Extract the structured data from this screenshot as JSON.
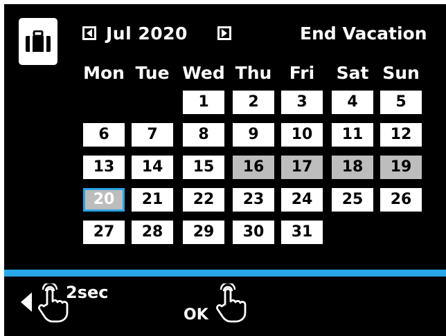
{
  "header": {
    "month_label": "Jul 2020",
    "end_button_label": "End Vacation",
    "prev_icon": "triangle-left-icon",
    "next_icon": "triangle-right-icon",
    "mode_icon": "suitcase-icon"
  },
  "calendar": {
    "weekdays": [
      "Mon",
      "Tue",
      "Wed",
      "Thu",
      "Fri",
      "Sat",
      "Sun"
    ],
    "weeks": [
      [
        "",
        "",
        "1",
        "2",
        "3",
        "4",
        "5"
      ],
      [
        "6",
        "7",
        "8",
        "9",
        "10",
        "11",
        "12"
      ],
      [
        "13",
        "14",
        "15",
        "16",
        "17",
        "18",
        "19"
      ],
      [
        "20",
        "21",
        "22",
        "23",
        "24",
        "25",
        "26"
      ],
      [
        "27",
        "28",
        "29",
        "30",
        "31",
        "",
        ""
      ]
    ],
    "selected_range_days": [
      "16",
      "17",
      "18",
      "19"
    ],
    "today": "20"
  },
  "footer": {
    "hold_label": "2sec",
    "ok_label": "OK",
    "back_icon": "triangle-left-icon",
    "touch_icon": "hand-pointer-icon"
  },
  "colors": {
    "background": "#000000",
    "accent": "#29a7e8",
    "range_fill": "#bdbdbd",
    "day_fill": "#ffffff"
  }
}
